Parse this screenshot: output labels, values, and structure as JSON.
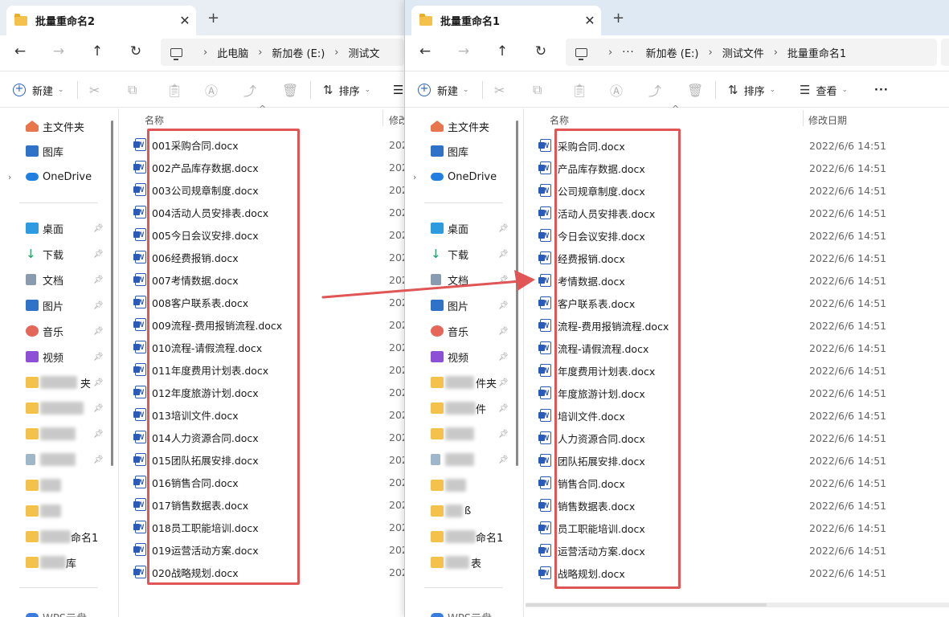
{
  "left": {
    "tab_title": "批量重命名2",
    "tab_close": "✕",
    "tab_new": "+",
    "path": [
      "此电脑",
      "新加卷 (E:)",
      "测试文"
    ],
    "column_name": "名称",
    "column_date": "修改",
    "date_partial": "202",
    "files": [
      "001采购合同.docx",
      "002产品库存数据.docx",
      "003公司规章制度.docx",
      "004活动人员安排表.docx",
      "005今日会议安排.docx",
      "006经费报销.docx",
      "007考情数据.docx",
      "008客户联系表.docx",
      "009流程-费用报销流程.docx",
      "010流程-请假流程.docx",
      "011年度费用计划表.docx",
      "012年度旅游计划.docx",
      "013培训文件.docx",
      "014人力资源合同.docx",
      "015团队拓展安排.docx",
      "016销售合同.docx",
      "017销售数据表.docx",
      "018员工职能培训.docx",
      "019运营活动方案.docx",
      "020战略规划.docx"
    ]
  },
  "right": {
    "tab_title": "批量重命名1",
    "tab_close": "✕",
    "tab_new": "+",
    "path_overflow": "···",
    "path": [
      "新加卷 (E:)",
      "测试文件",
      "批量重命名1"
    ],
    "column_name": "名称",
    "column_date": "修改日期",
    "date": "2022/6/6 14:51",
    "files": [
      "采购合同.docx",
      "产品库存数据.docx",
      "公司规章制度.docx",
      "活动人员安排表.docx",
      "今日会议安排.docx",
      "经费报销.docx",
      "考情数据.docx",
      "客户联系表.docx",
      "流程-费用报销流程.docx",
      "流程-请假流程.docx",
      "年度费用计划表.docx",
      "年度旅游计划.docx",
      "培训文件.docx",
      "人力资源合同.docx",
      "团队拓展安排.docx",
      "销售合同.docx",
      "销售数据表.docx",
      "员工职能培训.docx",
      "运营活动方案.docx",
      "战略规划.docx"
    ]
  },
  "toolbar": {
    "new_label": "新建",
    "sort_label": "排序",
    "view_label": "查看",
    "more": "···",
    "dropdown": "⌄"
  },
  "sidebar": {
    "home": "主文件夹",
    "gallery": "图库",
    "onedrive": "OneDrive",
    "desktop": "桌面",
    "downloads": "下载",
    "documents": "文档",
    "pictures": "图片",
    "music": "音乐",
    "videos": "视频",
    "left_frag_1": "夹",
    "right_frag_1": "件夹",
    "right_frag_2": "件",
    "frag_rename1": "命名1",
    "left_frag_last": "库",
    "right_frag_b": "ß",
    "right_frag_last": "表",
    "wps_partial": "WPS云盘"
  },
  "icons": [
    "back-arrow-icon",
    "forward-arrow-icon",
    "up-arrow-icon",
    "refresh-icon",
    "computer-icon",
    "cut-icon",
    "copy-icon",
    "paste-icon",
    "rename-icon",
    "share-icon",
    "delete-icon",
    "sort-icon",
    "view-icon",
    "pin-icon",
    "folder-icon",
    "word-doc-icon"
  ],
  "colors": {
    "highlight": "#e05555",
    "arrow": "#e05555",
    "accent": "#2b5bb8",
    "folder": "#f4c24a"
  }
}
